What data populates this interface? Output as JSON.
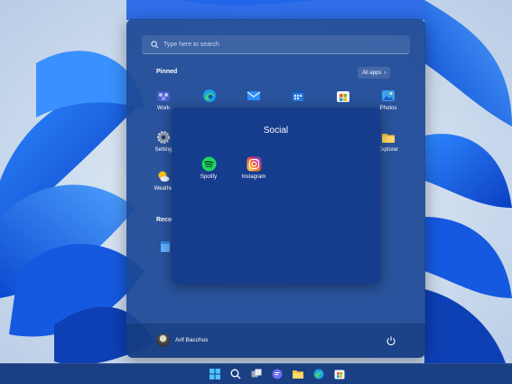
{
  "start_menu": {
    "search": {
      "placeholder": "Type here to search"
    },
    "pinned_label": "Pinned",
    "all_apps_label": "All apps",
    "pinned_apps": [
      {
        "label": "Work",
        "icon": "work-folder-icon"
      },
      {
        "label": "",
        "icon": "edge-icon"
      },
      {
        "label": "",
        "icon": "mail-icon"
      },
      {
        "label": "",
        "icon": "calendar-icon"
      },
      {
        "label": "",
        "icon": "store-icon"
      },
      {
        "label": "Photos",
        "icon": "photos-icon"
      },
      {
        "label": "Setting",
        "icon": "settings-icon"
      },
      {
        "label": "Explorer",
        "icon": "file-explorer-icon"
      },
      {
        "label": "Weathe",
        "icon": "weather-icon"
      }
    ],
    "recommended_label": "Recor",
    "user_name": "Arif Bacchus"
  },
  "folder": {
    "title": "Social",
    "apps": [
      {
        "label": "Spotify",
        "icon": "spotify-icon",
        "color": "#1ed760"
      },
      {
        "label": "Instagram",
        "icon": "instagram-icon",
        "color": "#d62976"
      }
    ]
  },
  "taskbar": {
    "items": [
      "windows-start-icon",
      "search-icon",
      "task-view-icon",
      "chat-icon",
      "file-explorer-icon",
      "edge-icon",
      "store-icon"
    ]
  },
  "colors": {
    "start_bg": "#1c4896",
    "accent": "#1e72d8",
    "taskbar": "#1a3f82"
  }
}
